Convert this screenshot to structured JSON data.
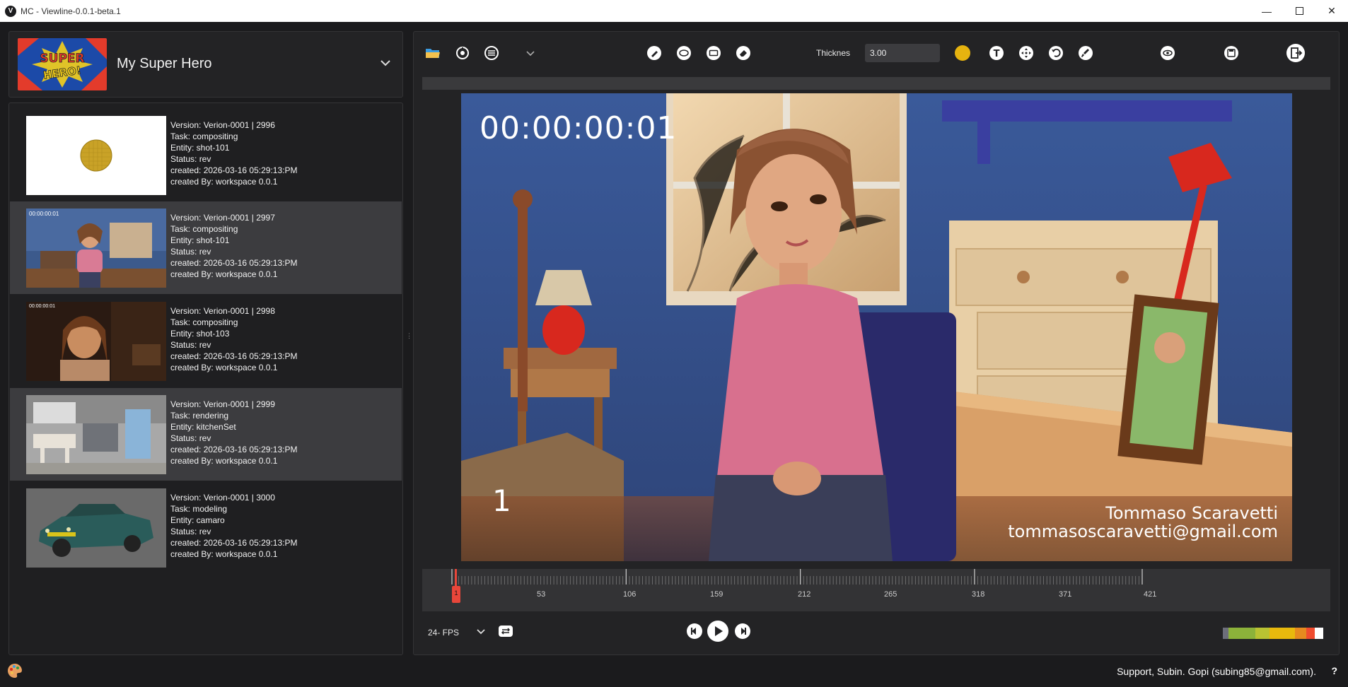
{
  "window": {
    "title": "MC - Viewline-0.0.1-beta.1",
    "app_icon_letter": "V",
    "controls": [
      "minimize-icon",
      "maximize-icon",
      "close-icon"
    ]
  },
  "project": {
    "name": "My Super Hero",
    "logo_text": "SUPER HERO!"
  },
  "versions": [
    {
      "version": "Version: Verion-0001 | 2996",
      "task": "Task: compositing",
      "entity": "Entity: shot-101",
      "status": "Status: rev",
      "created": "created: 2026-03-16 05:29:13:PM",
      "created_by": "created By: workspace 0.0.1",
      "selected": false
    },
    {
      "version": "Version: Verion-0001 | 2997",
      "task": "Task: compositing",
      "entity": "Entity: shot-101",
      "status": "Status: rev",
      "created": "created: 2026-03-16 05:29:13:PM",
      "created_by": "created By: workspace 0.0.1",
      "selected": true
    },
    {
      "version": "Version: Verion-0001 | 2998",
      "task": "Task: compositing",
      "entity": "Entity: shot-103",
      "status": "Status: rev",
      "created": "created: 2026-03-16 05:29:13:PM",
      "created_by": "created By: workspace 0.0.1",
      "selected": false
    },
    {
      "version": "Version: Verion-0001 | 2999",
      "task": "Task: rendering",
      "entity": "Entity: kitchenSet",
      "status": "Status: rev",
      "created": "created: 2026-03-16 05:29:13:PM",
      "created_by": "created By: workspace 0.0.1",
      "selected": true
    },
    {
      "version": "Version: Verion-0001 | 3000",
      "task": "Task: modeling",
      "entity": "Entity: camaro",
      "status": "Status: rev",
      "created": "created: 2026-03-16 05:29:13:PM",
      "created_by": "created By: workspace 0.0.1",
      "selected": false
    }
  ],
  "thumbnails": {
    "thumb2_timecode": "00:00:00:01",
    "thumb3_timecode": "00:00:00:01"
  },
  "toolbar": {
    "left_icons": [
      "open-folder-icon",
      "color-picker-icon",
      "adjustments-icon",
      "chevron-down-icon"
    ],
    "draw_icons": [
      "pen-icon",
      "ellipse-icon",
      "rectangle-icon",
      "eraser-icon"
    ],
    "thickness_label": "Thicknes",
    "thickness_value": "3.00",
    "brush_color": "#e6b30f",
    "tool_icons": [
      "text-icon",
      "move-icon",
      "undo-icon",
      "clear-icon"
    ],
    "right_icons": [
      "eye-icon",
      "save-icon",
      "exit-icon"
    ]
  },
  "viewer": {
    "timecode": "00:00:00:01",
    "frame_number": "1",
    "credit_name": "Tommaso Scaravetti",
    "credit_email": "tommasoscaravetti@gmail.com"
  },
  "timeline": {
    "start": 1,
    "end": 421,
    "current_frame": "1",
    "labels": [
      "53",
      "106",
      "159",
      "212",
      "265",
      "318",
      "371",
      "421"
    ]
  },
  "playback": {
    "fps": "24- FPS",
    "controls": [
      "previous-frame-icon",
      "play-icon",
      "next-frame-icon"
    ],
    "loop_icon": "loop-icon"
  },
  "level_meter_colors": [
    "#6c6e7a",
    "#8cb23a",
    "#b9c232",
    "#e8b90d",
    "#e68a1f",
    "#f04c2f",
    "#ffffff"
  ],
  "footer": {
    "support": "Support, Subin. Gopi (subing85@gmail.com).",
    "help": "?",
    "palette_icon": "palette-icon"
  }
}
